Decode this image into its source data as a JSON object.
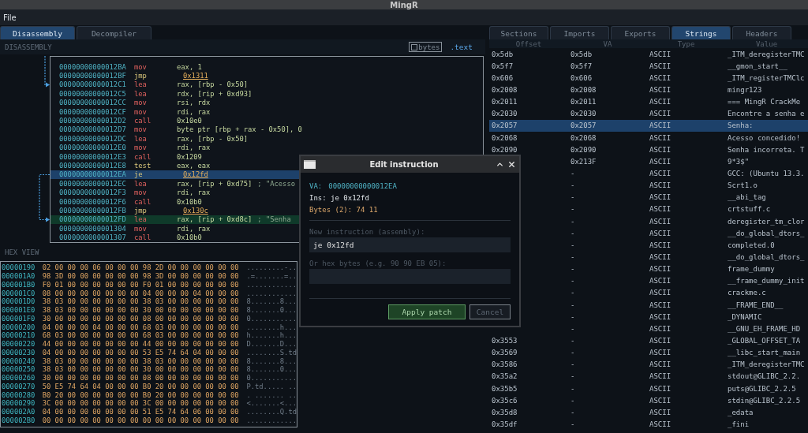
{
  "window": {
    "title": "MingR"
  },
  "menu": [
    {
      "label": "File"
    }
  ],
  "left_tabs": [
    {
      "label": "Disassembly",
      "selected": true
    },
    {
      "label": "Decompiler",
      "selected": false
    }
  ],
  "disassembly": {
    "title": "DISASSEMBLY",
    "bytes_toggle": {
      "label": "bytes",
      "checked": false
    },
    "section": ".text",
    "rows": [
      {
        "address": "00000000000012BA",
        "mnemonic": "mov",
        "kind": "data",
        "operands": "eax, 1",
        "link": false,
        "selected": false,
        "target": false
      },
      {
        "address": "00000000000012BF",
        "mnemonic": "jmp",
        "kind": "branch",
        "operands": "0x1311",
        "link": true,
        "selected": false,
        "target": false
      },
      {
        "address": "00000000000012C1",
        "mnemonic": "lea",
        "kind": "data",
        "operands": "rax, [rbp - 0x50]",
        "link": false,
        "selected": false,
        "target": false,
        "arrow_in": true
      },
      {
        "address": "00000000000012C5",
        "mnemonic": "lea",
        "kind": "data",
        "operands": "rdx, [rip + 0xd93]",
        "link": false,
        "selected": false,
        "target": false
      },
      {
        "address": "00000000000012CC",
        "mnemonic": "mov",
        "kind": "data",
        "operands": "rsi, rdx",
        "link": false,
        "selected": false,
        "target": false
      },
      {
        "address": "00000000000012CF",
        "mnemonic": "mov",
        "kind": "data",
        "operands": "rdi, rax",
        "link": false,
        "selected": false,
        "target": false
      },
      {
        "address": "00000000000012D2",
        "mnemonic": "call",
        "kind": "data",
        "operands": "0x10e0",
        "link": false,
        "selected": false,
        "target": false
      },
      {
        "address": "00000000000012D7",
        "mnemonic": "mov",
        "kind": "data",
        "operands": "byte ptr [rbp + rax - 0x50], 0",
        "link": false,
        "selected": false,
        "target": false
      },
      {
        "address": "00000000000012DC",
        "mnemonic": "lea",
        "kind": "data",
        "operands": "rax, [rbp - 0x50]",
        "link": false,
        "selected": false,
        "target": false
      },
      {
        "address": "00000000000012E0",
        "mnemonic": "mov",
        "kind": "data",
        "operands": "rdi, rax",
        "link": false,
        "selected": false,
        "target": false
      },
      {
        "address": "00000000000012E3",
        "mnemonic": "call",
        "kind": "data",
        "operands": "0x1209",
        "link": false,
        "selected": false,
        "target": false
      },
      {
        "address": "00000000000012E8",
        "mnemonic": "test",
        "kind": "branch",
        "operands": "eax, eax",
        "link": false,
        "selected": false,
        "target": false
      },
      {
        "address": "00000000000012EA",
        "mnemonic": "je",
        "kind": "branch",
        "operands": "0x12fd",
        "link": true,
        "selected": true,
        "target": false,
        "arrow_out": true
      },
      {
        "address": "00000000000012EC",
        "mnemonic": "lea",
        "kind": "data",
        "operands": "rax, [rip + 0xd75]",
        "comment": "; \"Acesso",
        "link": false,
        "selected": false,
        "target": false
      },
      {
        "address": "00000000000012F3",
        "mnemonic": "mov",
        "kind": "data",
        "operands": "rdi, rax",
        "link": false,
        "selected": false,
        "target": false
      },
      {
        "address": "00000000000012F6",
        "mnemonic": "call",
        "kind": "data",
        "operands": "0x10b0",
        "link": false,
        "selected": false,
        "target": false
      },
      {
        "address": "00000000000012FB",
        "mnemonic": "jmp",
        "kind": "branch",
        "operands": "0x130c",
        "link": true,
        "selected": false,
        "target": false
      },
      {
        "address": "00000000000012FD",
        "mnemonic": "lea",
        "kind": "data",
        "operands": "rax, [rip + 0xd8c]",
        "comment": "; \"Senha",
        "link": false,
        "selected": false,
        "target": true,
        "arrow_in": true
      },
      {
        "address": "0000000000001304",
        "mnemonic": "mov",
        "kind": "data",
        "operands": "rdi, rax",
        "link": false,
        "selected": false,
        "target": false
      },
      {
        "address": "0000000000001307",
        "mnemonic": "call",
        "kind": "data",
        "operands": "0x10b0",
        "link": false,
        "selected": false,
        "target": false
      }
    ]
  },
  "hex_view": {
    "title": "HEX VIEW",
    "rows": [
      {
        "address": "00000190",
        "bytes": "02 00 00 00 06 00 00 00 98 2D 00 00 00 00 00 00",
        "ascii": ".........-.."
      },
      {
        "address": "000001A0",
        "bytes": "98 3D 00 00 00 00 00 00 98 3D 00 00 00 00 00 00",
        "ascii": ".=.......=.."
      },
      {
        "address": "000001B0",
        "bytes": "F0 01 00 00 00 00 00 00 F0 01 00 00 00 00 00 00",
        "ascii": "............"
      },
      {
        "address": "000001C0",
        "bytes": "08 00 00 00 00 00 00 00 04 00 00 00 04 00 00 00",
        "ascii": "............"
      },
      {
        "address": "000001D0",
        "bytes": "38 03 00 00 00 00 00 00 38 03 00 00 00 00 00 00",
        "ascii": "8.......8..."
      },
      {
        "address": "000001E0",
        "bytes": "38 03 00 00 00 00 00 00 30 00 00 00 00 00 00 00",
        "ascii": "8.......0..."
      },
      {
        "address": "000001F0",
        "bytes": "30 00 00 00 00 00 00 00 08 00 00 00 00 00 00 00",
        "ascii": "0..........."
      },
      {
        "address": "00000200",
        "bytes": "04 00 00 00 04 00 00 00 68 03 00 00 00 00 00 00",
        "ascii": "........h..."
      },
      {
        "address": "00000210",
        "bytes": "68 03 00 00 00 00 00 00 68 03 00 00 00 00 00 00",
        "ascii": "h.......h..."
      },
      {
        "address": "00000220",
        "bytes": "44 00 00 00 00 00 00 00 44 00 00 00 00 00 00 00",
        "ascii": "D.......D..."
      },
      {
        "address": "00000230",
        "bytes": "04 00 00 00 00 00 00 00 53 E5 74 64 04 00 00 00",
        "ascii": "........S.td"
      },
      {
        "address": "00000240",
        "bytes": "38 03 00 00 00 00 00 00 38 03 00 00 00 00 00 00",
        "ascii": "8.......8..."
      },
      {
        "address": "00000250",
        "bytes": "38 03 00 00 00 00 00 00 30 00 00 00 00 00 00 00",
        "ascii": "8.......0..."
      },
      {
        "address": "00000260",
        "bytes": "30 00 00 00 00 00 00 00 08 00 00 00 00 00 00 00",
        "ascii": "0..........."
      },
      {
        "address": "00000270",
        "bytes": "50 E5 74 64 04 00 00 00 B0 20 00 00 00 00 00 00",
        "ascii": "P.td..... .."
      },
      {
        "address": "00000280",
        "bytes": "B0 20 00 00 00 00 00 00 B0 20 00 00 00 00 00 00",
        "ascii": ". ....... .."
      },
      {
        "address": "00000290",
        "bytes": "3C 00 00 00 00 00 00 00 3C 00 00 00 00 00 00 00",
        "ascii": "<.......<..."
      },
      {
        "address": "000002A0",
        "bytes": "04 00 00 00 00 00 00 00 51 E5 74 64 06 00 00 00",
        "ascii": "........Q.td"
      },
      {
        "address": "000002B0",
        "bytes": "00 00 00 00 00 00 00 00 00 00 00 00 00 00 00 00",
        "ascii": "............"
      }
    ]
  },
  "right_tabs": [
    {
      "label": "Sections",
      "selected": false
    },
    {
      "label": "Imports",
      "selected": false
    },
    {
      "label": "Exports",
      "selected": false
    },
    {
      "label": "Strings",
      "selected": true
    },
    {
      "label": "Headers",
      "selected": false
    }
  ],
  "strings": {
    "columns": [
      "Offset",
      "VA",
      "Type",
      "Value"
    ],
    "rows": [
      {
        "offset": "0x5db",
        "va": "0x5db",
        "type": "ASCII",
        "value": "_ITM_deregisterTMC",
        "selected": false
      },
      {
        "offset": "0x5f7",
        "va": "0x5f7",
        "type": "ASCII",
        "value": "__gmon_start__",
        "selected": false
      },
      {
        "offset": "0x606",
        "va": "0x606",
        "type": "ASCII",
        "value": "_ITM_registerTMClc",
        "selected": false
      },
      {
        "offset": "0x2008",
        "va": "0x2008",
        "type": "ASCII",
        "value": "mingr123",
        "selected": false
      },
      {
        "offset": "0x2011",
        "va": "0x2011",
        "type": "ASCII",
        "value": "=== MingR CrackMe",
        "selected": false
      },
      {
        "offset": "0x2030",
        "va": "0x2030",
        "type": "ASCII",
        "value": "Encontre a senha e",
        "selected": false
      },
      {
        "offset": "0x2057",
        "va": "0x2057",
        "type": "ASCII",
        "value": "Senha:",
        "selected": true
      },
      {
        "offset": "0x2068",
        "va": "0x2068",
        "type": "ASCII",
        "value": "Acesso concedido!",
        "selected": false
      },
      {
        "offset": "0x2090",
        "va": "0x2090",
        "type": "ASCII",
        "value": "Senha incorreta. T",
        "selected": false
      },
      {
        "va": "0x213F",
        "type": "ASCII",
        "value": "9*3$\"",
        "selected": false
      },
      {
        "va": "-",
        "type": "ASCII",
        "value": "GCC: (Ubuntu 13.3.",
        "selected": false
      },
      {
        "va": "-",
        "type": "ASCII",
        "value": "Scrt1.o",
        "selected": false
      },
      {
        "va": "-",
        "type": "ASCII",
        "value": "__abi_tag",
        "selected": false
      },
      {
        "va": "-",
        "type": "ASCII",
        "value": "crtstuff.c",
        "selected": false
      },
      {
        "va": "-",
        "type": "ASCII",
        "value": "deregister_tm_clor",
        "selected": false
      },
      {
        "va": "-",
        "type": "ASCII",
        "value": "__do_global_dtors_",
        "selected": false
      },
      {
        "va": "-",
        "type": "ASCII",
        "value": "completed.0",
        "selected": false
      },
      {
        "va": "-",
        "type": "ASCII",
        "value": "__do_global_dtors_",
        "selected": false
      },
      {
        "va": "-",
        "type": "ASCII",
        "value": "frame_dummy",
        "selected": false
      },
      {
        "va": "-",
        "type": "ASCII",
        "value": "__frame_dummy_init",
        "selected": false
      },
      {
        "va": "-",
        "type": "ASCII",
        "value": "crackme.c",
        "selected": false
      },
      {
        "va": "-",
        "type": "ASCII",
        "value": "__FRAME_END__",
        "selected": false
      },
      {
        "va": "-",
        "type": "ASCII",
        "value": "_DYNAMIC",
        "selected": false
      },
      {
        "va": "-",
        "type": "ASCII",
        "value": "__GNU_EH_FRAME_HD",
        "selected": false
      },
      {
        "offset": "0x3553",
        "va": "-",
        "type": "ASCII",
        "value": "_GLOBAL_OFFSET_TA",
        "selected": false
      },
      {
        "offset": "0x3569",
        "va": "-",
        "type": "ASCII",
        "value": "__libc_start_main",
        "selected": false
      },
      {
        "offset": "0x3586",
        "va": "-",
        "type": "ASCII",
        "value": "_ITM_deregisterTMC",
        "selected": false
      },
      {
        "offset": "0x35a2",
        "va": "-",
        "type": "ASCII",
        "value": "stdout@GLIBC_2.2.",
        "selected": false
      },
      {
        "offset": "0x35b5",
        "va": "-",
        "type": "ASCII",
        "value": "puts@GLIBC_2.2.5",
        "selected": false
      },
      {
        "offset": "0x35c6",
        "va": "-",
        "type": "ASCII",
        "value": "stdin@GLIBC_2.2.5",
        "selected": false
      },
      {
        "offset": "0x35d8",
        "va": "-",
        "type": "ASCII",
        "value": "_edata",
        "selected": false
      },
      {
        "offset": "0x35df",
        "va": "-",
        "type": "ASCII",
        "value": "_fini",
        "selected": false
      }
    ]
  },
  "dialog": {
    "title": "Edit instruction",
    "va_label": "VA:",
    "va": "00000000000012EA",
    "ins": "Ins: je 0x12fd",
    "bytes": "Bytes (2): 74 11",
    "asm_label": "New instruction (assembly):",
    "asm_value": "je 0x12fd",
    "hex_label": "Or hex bytes (e.g. 90 90 EB 05):",
    "buttons": [
      {
        "label": "Apply patch",
        "kind": "primary"
      },
      {
        "label": "Cancel",
        "kind": "secondary"
      }
    ]
  }
}
